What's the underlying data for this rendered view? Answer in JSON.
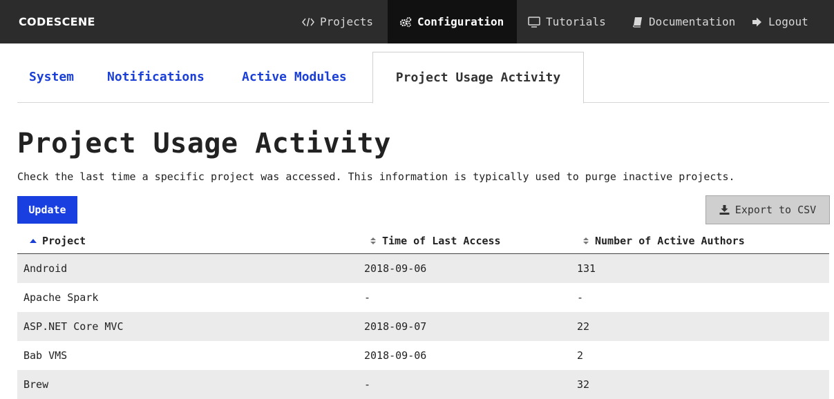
{
  "navbar": {
    "brand": "CODESCENE",
    "items": [
      {
        "label": "Projects",
        "icon": "code-icon"
      },
      {
        "label": "Configuration",
        "icon": "cogs-icon",
        "active": true
      },
      {
        "label": "Tutorials",
        "icon": "monitor-icon"
      },
      {
        "label": "Documentation",
        "icon": "book-icon"
      },
      {
        "label": "Logout",
        "icon": "sign-out-icon"
      }
    ]
  },
  "tabs": [
    {
      "label": "System"
    },
    {
      "label": "Notifications"
    },
    {
      "label": "Active Modules"
    },
    {
      "label": "Project Usage Activity",
      "active": true
    }
  ],
  "page": {
    "title": "Project Usage Activity",
    "description": "Check the last time a specific project was accessed. This information is typically used to purge inactive projects.",
    "update_label": "Update",
    "export_label": "Export to CSV"
  },
  "table": {
    "columns": [
      {
        "label": "Project",
        "sort": "asc"
      },
      {
        "label": "Time of Last Access",
        "sort": "none"
      },
      {
        "label": "Number of Active Authors",
        "sort": "none"
      }
    ],
    "rows": [
      {
        "project": "Android",
        "last_access": "2018-09-06",
        "authors": "131"
      },
      {
        "project": "Apache Spark",
        "last_access": "-",
        "authors": "-"
      },
      {
        "project": "ASP.NET Core MVC",
        "last_access": "2018-09-07",
        "authors": "22"
      },
      {
        "project": "Bab VMS",
        "last_access": "2018-09-06",
        "authors": "2"
      },
      {
        "project": "Brew",
        "last_access": "-",
        "authors": "32"
      }
    ]
  },
  "colors": {
    "navbar_bg": "#2c2c2c",
    "navbar_active_bg": "#111111",
    "link_blue": "#1a3fd6",
    "update_button": "#1a3fe0",
    "row_stripe": "#ebebeb"
  }
}
